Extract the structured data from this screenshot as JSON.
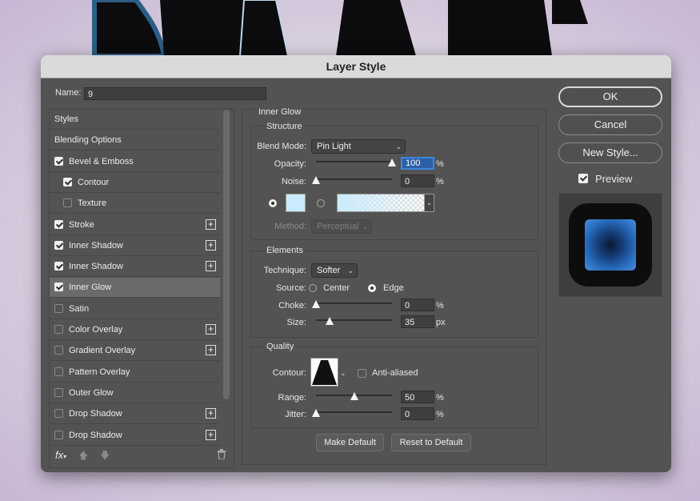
{
  "dialog": {
    "title": "Layer Style"
  },
  "name_field": {
    "label": "Name:",
    "value": "9"
  },
  "styles": [
    {
      "label": "Styles",
      "checkbox": false,
      "checked": false,
      "indent": false,
      "plus": false,
      "selected": false
    },
    {
      "label": "Blending Options",
      "checkbox": false,
      "checked": false,
      "indent": false,
      "plus": false,
      "selected": false
    },
    {
      "label": "Bevel & Emboss",
      "checkbox": true,
      "checked": true,
      "indent": false,
      "plus": false,
      "selected": false
    },
    {
      "label": "Contour",
      "checkbox": true,
      "checked": true,
      "indent": true,
      "plus": false,
      "selected": false
    },
    {
      "label": "Texture",
      "checkbox": true,
      "checked": false,
      "indent": true,
      "plus": false,
      "selected": false
    },
    {
      "label": "Stroke",
      "checkbox": true,
      "checked": true,
      "indent": false,
      "plus": true,
      "selected": false
    },
    {
      "label": "Inner Shadow",
      "checkbox": true,
      "checked": true,
      "indent": false,
      "plus": true,
      "selected": false
    },
    {
      "label": "Inner Shadow",
      "checkbox": true,
      "checked": true,
      "indent": false,
      "plus": true,
      "selected": false
    },
    {
      "label": "Inner Glow",
      "checkbox": true,
      "checked": true,
      "indent": false,
      "plus": false,
      "selected": true
    },
    {
      "label": "Satin",
      "checkbox": true,
      "checked": false,
      "indent": false,
      "plus": false,
      "selected": false
    },
    {
      "label": "Color Overlay",
      "checkbox": true,
      "checked": false,
      "indent": false,
      "plus": true,
      "selected": false
    },
    {
      "label": "Gradient Overlay",
      "checkbox": true,
      "checked": false,
      "indent": false,
      "plus": true,
      "selected": false
    },
    {
      "label": "Pattern Overlay",
      "checkbox": true,
      "checked": false,
      "indent": false,
      "plus": false,
      "selected": false
    },
    {
      "label": "Outer Glow",
      "checkbox": true,
      "checked": false,
      "indent": false,
      "plus": false,
      "selected": false
    },
    {
      "label": "Drop Shadow",
      "checkbox": true,
      "checked": false,
      "indent": false,
      "plus": true,
      "selected": false
    },
    {
      "label": "Drop Shadow",
      "checkbox": true,
      "checked": false,
      "indent": false,
      "plus": true,
      "selected": false
    }
  ],
  "list_footer": {
    "fx_label": "fx",
    "icons": [
      "move-up-icon",
      "move-down-icon",
      "trash-icon"
    ]
  },
  "inner_glow": {
    "section_title": "Inner Glow",
    "structure": {
      "title": "Structure",
      "blend_mode_label": "Blend Mode:",
      "blend_mode": "Pin Light",
      "opacity_label": "Opacity:",
      "opacity_value": "100",
      "opacity_unit": "%",
      "opacity_fraction": 1.0,
      "noise_label": "Noise:",
      "noise_value": "0",
      "noise_unit": "%",
      "noise_fraction": 0.0,
      "glow_color": "#c9ebfb",
      "gradient_from": "#c9ebfb",
      "method_label": "Method:",
      "method_value": "Perceptual"
    },
    "elements": {
      "title": "Elements",
      "technique_label": "Technique:",
      "technique_value": "Softer",
      "source_label": "Source:",
      "source_center": "Center",
      "source_edge": "Edge",
      "source_selected": "Edge",
      "choke_label": "Choke:",
      "choke_value": "0",
      "choke_unit": "%",
      "choke_fraction": 0.0,
      "size_label": "Size:",
      "size_value": "35",
      "size_unit": "px",
      "size_fraction": 0.18
    },
    "quality": {
      "title": "Quality",
      "contour_label": "Contour:",
      "anti_aliased_label": "Anti-aliased",
      "anti_aliased": false,
      "range_label": "Range:",
      "range_value": "50",
      "range_unit": "%",
      "range_fraction": 0.5,
      "jitter_label": "Jitter:",
      "jitter_value": "0",
      "jitter_unit": "%",
      "jitter_fraction": 0.0
    },
    "make_default": "Make Default",
    "reset_default": "Reset to Default"
  },
  "buttons": {
    "ok": "OK",
    "cancel": "Cancel",
    "new_style": "New Style...",
    "preview_label": "Preview",
    "preview_checked": true
  },
  "colors": {
    "dialog_bg": "#535353",
    "selected_row": "#6b6b6b",
    "focus_blue": "#2d5fa6",
    "preview_glow": "#2a6fc0"
  }
}
